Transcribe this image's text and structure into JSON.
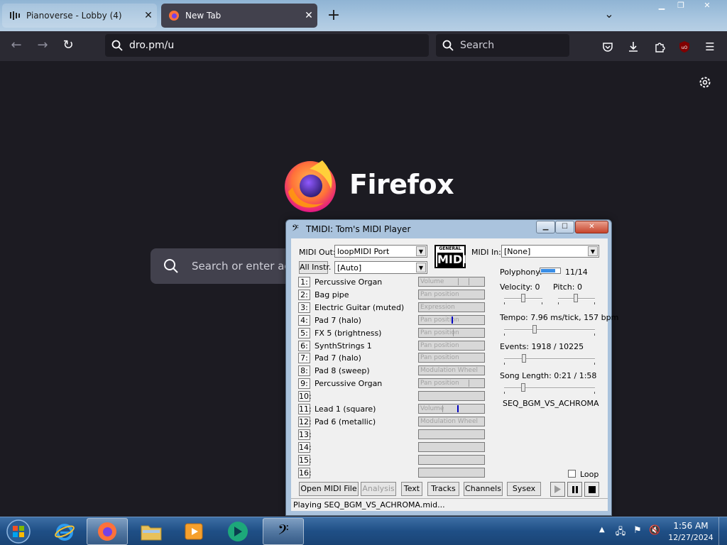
{
  "browser": {
    "tabs": [
      {
        "title": "Pianoverse - Lobby (4)",
        "active": false
      },
      {
        "title": "New Tab",
        "active": true
      }
    ],
    "url": "dro.pm/u",
    "search_placeholder": "Search",
    "colors": {
      "tabbar": "#a9c6e0",
      "toolbar": "#2b2a33",
      "page": "#1c1b22",
      "accent": "#ff7139"
    }
  },
  "newtab": {
    "brand": "Firefox",
    "search_placeholder": "Search or enter addr"
  },
  "tmidi": {
    "title": "TMIDI: Tom's MIDI Player",
    "midi_out_label": "MIDI Out:",
    "midi_out_value": "loopMIDI Port",
    "midi_in_label": "MIDI In:",
    "midi_in_value": "[None]",
    "all_instr_button": "All Instr.",
    "instr_mode_value": "[Auto]",
    "gm_logo_top": "GENERAL",
    "gm_logo_bottom": "MIDI",
    "channels": [
      {
        "num": "1:",
        "instrument": "Percussive Organ",
        "control": "Volume"
      },
      {
        "num": "2:",
        "instrument": "Bag pipe",
        "control": "Pan position"
      },
      {
        "num": "3:",
        "instrument": "Electric Guitar (muted)",
        "control": "Expression"
      },
      {
        "num": "4:",
        "instrument": "Pad 7 (halo)",
        "control": "Pan position"
      },
      {
        "num": "5:",
        "instrument": "FX 5 (brightness)",
        "control": "Pan position"
      },
      {
        "num": "6:",
        "instrument": "SynthStrings 1",
        "control": "Pan position"
      },
      {
        "num": "7:",
        "instrument": "Pad 7 (halo)",
        "control": "Pan position"
      },
      {
        "num": "8:",
        "instrument": "Pad 8 (sweep)",
        "control": "Modulation Wheel"
      },
      {
        "num": "9:",
        "instrument": "Percussive Organ",
        "control": "Pan position"
      },
      {
        "num": "10:",
        "instrument": "",
        "control": ""
      },
      {
        "num": "11:",
        "instrument": "Lead 1 (square)",
        "control": "Volume"
      },
      {
        "num": "12:",
        "instrument": "Pad 6 (metallic)",
        "control": "Modulation Wheel"
      },
      {
        "num": "13:",
        "instrument": "",
        "control": ""
      },
      {
        "num": "14:",
        "instrument": "",
        "control": ""
      },
      {
        "num": "15:",
        "instrument": "",
        "control": ""
      },
      {
        "num": "16:",
        "instrument": "",
        "control": ""
      }
    ],
    "polyphony_label": "Polyphony:",
    "polyphony_value": "11/14",
    "polyphony_fraction": 0.7857,
    "velocity_label": "Velocity: 0",
    "pitch_label": "Pitch: 0",
    "tempo_label": "Tempo: 7.96 ms/tick, 157 bpm",
    "events_label": "Events: 1918 / 10225",
    "song_length_label": "Song Length: 0:21 / 1:58",
    "song_name": "SEQ_BGM_VS_ACHROMA",
    "loop_label": "Loop",
    "loop_checked": false,
    "buttons": {
      "open": "Open MIDI File",
      "analysis": "Analysis",
      "text": "Text",
      "tracks": "Tracks",
      "channels": "Channels",
      "sysex": "Sysex"
    },
    "status": "Playing SEQ_BGM_VS_ACHROMA.mid..."
  },
  "taskbar": {
    "apps": [
      "internet-explorer",
      "firefox",
      "file-explorer",
      "media-player",
      "pianoverse",
      "tmidi"
    ],
    "clock_time": "1:56 AM",
    "clock_date": "12/27/2024"
  }
}
